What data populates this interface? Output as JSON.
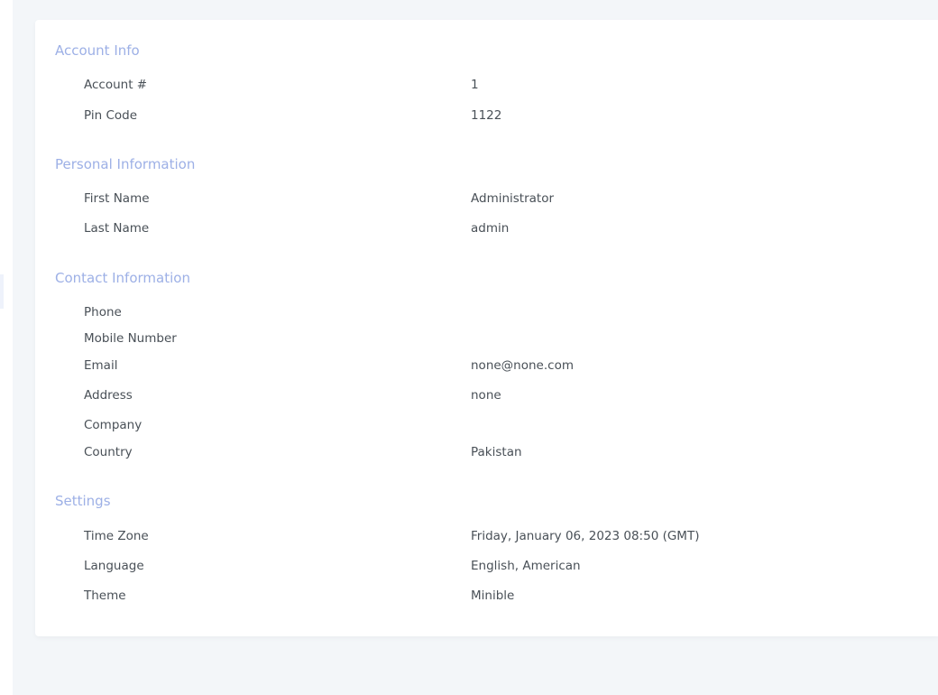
{
  "sections": [
    {
      "title": "Account Info",
      "rows": [
        {
          "label": "Account #",
          "value": "1"
        },
        {
          "label": "Pin Code",
          "value": "1122"
        }
      ]
    },
    {
      "title": "Personal Information",
      "rows": [
        {
          "label": "First Name",
          "value": "Administrator"
        },
        {
          "label": "Last Name",
          "value": "admin"
        }
      ]
    },
    {
      "title": "Contact Information",
      "rows": [
        {
          "label": "Phone",
          "value": ""
        },
        {
          "label": "Mobile Number",
          "value": ""
        },
        {
          "label": "Email",
          "value": "none@none.com"
        },
        {
          "label": "Address",
          "value": "none"
        },
        {
          "label": "Company",
          "value": ""
        },
        {
          "label": "Country",
          "value": "Pakistan"
        }
      ]
    },
    {
      "title": "Settings",
      "rows": [
        {
          "label": "Time Zone",
          "value": "Friday, January 06, 2023 08:50 (GMT)"
        },
        {
          "label": "Language",
          "value": "English, American"
        },
        {
          "label": "Theme",
          "value": "Minible"
        }
      ]
    }
  ],
  "colors": {
    "section_title": "#9db0e6",
    "text": "#495057",
    "background": "#f3f6f9",
    "card": "#ffffff"
  }
}
